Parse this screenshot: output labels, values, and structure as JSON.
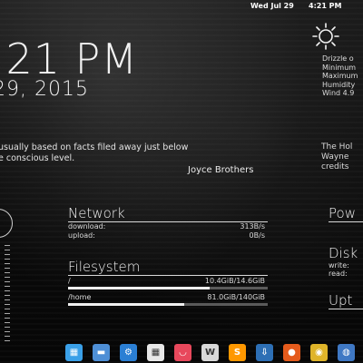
{
  "top_panel": {
    "date": "Wed Jul 29",
    "time": "4:21 PM"
  },
  "clock": {
    "time": ":21 PM",
    "date": "29, 2015"
  },
  "weather": {
    "icon": "sun-icon",
    "lines": [
      "Drizzle o",
      "Minimum",
      "Maximum",
      "Humidity",
      "Wind  4.9"
    ]
  },
  "quote": {
    "lines": [
      "usually based on facts filed away just below",
      "e conscious level."
    ],
    "author": "Joyce Brothers"
  },
  "side_quote": {
    "lines": [
      "The Hol",
      "Wayne",
      "credits"
    ]
  },
  "network": {
    "title": "Network",
    "download_label": "download:",
    "download_value": "313B/s",
    "upload_label": "upload:",
    "upload_value": "0B/s"
  },
  "filesystem": {
    "title": "Filesystem",
    "mounts": [
      {
        "path": "/",
        "usage": "10.4GiB/14.6GiB",
        "fraction": 0.71
      },
      {
        "path": "/home",
        "usage": "81.0GiB/140GiB",
        "fraction": 0.58
      }
    ]
  },
  "right_column": {
    "power_title": "Pow",
    "disk_title": "Disk",
    "write_label": "write:",
    "read_label": "read:",
    "uptime_title": "Upt"
  },
  "dock": {
    "items": [
      {
        "icon": "workspace-icon",
        "color": "#3aa0e8",
        "glyph": "▦"
      },
      {
        "icon": "folder-icon",
        "color": "#4e8fd6",
        "glyph": "▬"
      },
      {
        "icon": "settings-gear-icon",
        "color": "#2b7fd4",
        "glyph": "⚙"
      },
      {
        "icon": "apps-grid-icon",
        "color": "#e8e8e8",
        "glyph": "▦"
      },
      {
        "icon": "pocket-icon",
        "color": "#e8485c",
        "glyph": "◡"
      },
      {
        "icon": "writer-icon",
        "color": "#d9d9d9",
        "glyph": "W"
      },
      {
        "icon": "sublime-text-icon",
        "color": "#ff9800",
        "glyph": "S"
      },
      {
        "icon": "download-icon",
        "color": "#2d6fb5",
        "glyph": "⇩"
      },
      {
        "icon": "firefox-icon",
        "color": "#e55b1c",
        "glyph": "●"
      },
      {
        "icon": "chrome-icon",
        "color": "#dfb429",
        "glyph": "◉"
      },
      {
        "icon": "browser-icon",
        "color": "#3f78c4",
        "glyph": "◍"
      }
    ]
  }
}
